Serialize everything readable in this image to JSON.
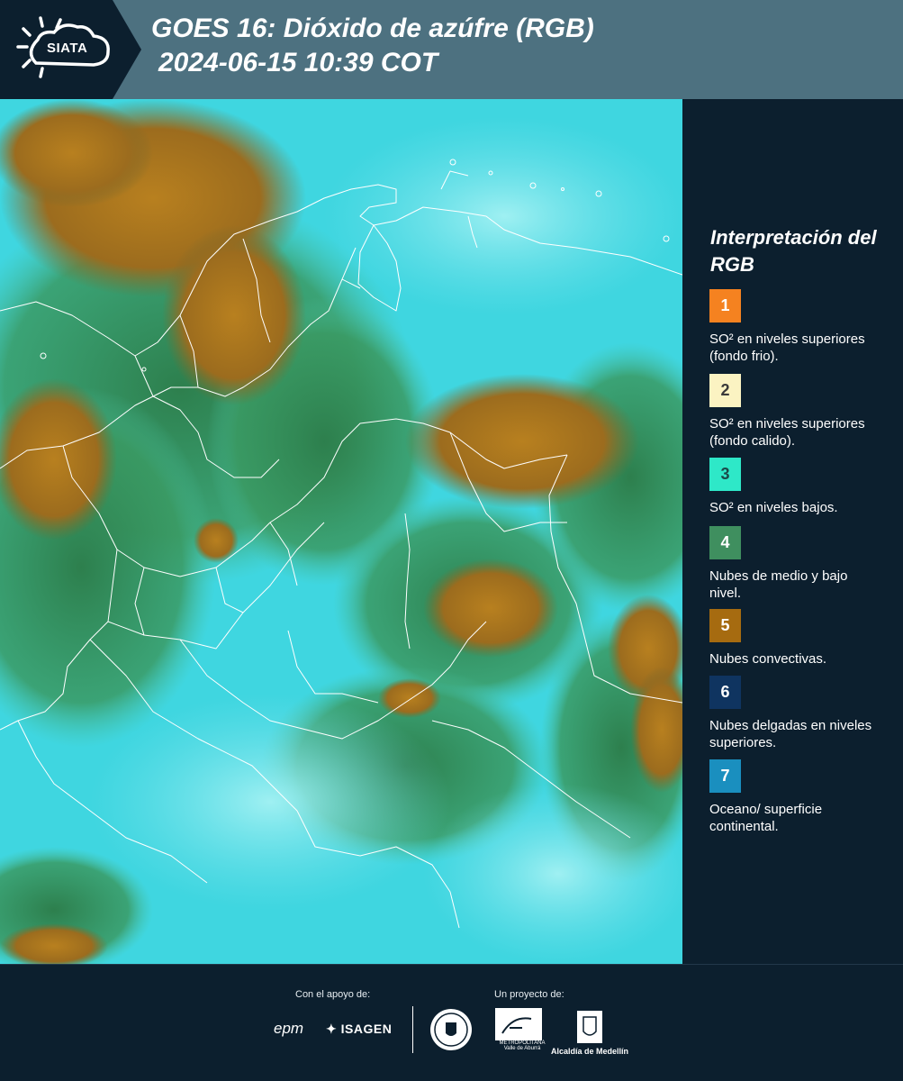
{
  "header": {
    "logo_text": "SIATA",
    "title": "GOES 16: Dióxido de azúfre (RGB)",
    "subtitle": "2024-06-15 10:39 COT"
  },
  "map": {
    "product": "GOES 16 SO2 RGB composite",
    "region": "Colombia",
    "colors": {
      "ocean_surface": "#3fd6e0",
      "mid_low_cloud": "#2f8a55",
      "convective_cloud": "#a8741f",
      "border_line": "#ffffff"
    }
  },
  "legend": {
    "title": "Interpretación del RGB",
    "items": [
      {
        "number": "1",
        "label": "SO² en niveles superiores (fondo frio).",
        "color": "#f58220",
        "text_color": "#ffffff"
      },
      {
        "number": "2",
        "label": "SO² en niveles superiores (fondo calido).",
        "color": "#fbf3c2",
        "text_color": "#3a3a3a"
      },
      {
        "number": "3",
        "label": "SO² en niveles bajos.",
        "color": "#2ee8c8",
        "text_color": "#1b4a4a"
      },
      {
        "number": "4",
        "label": "Nubes de medio y bajo nivel.",
        "color": "#3f8f5f",
        "text_color": "#ffffff"
      },
      {
        "number": "5",
        "label": "Nubes convectivas.",
        "color": "#a66b10",
        "text_color": "#ffffff"
      },
      {
        "number": "6",
        "label": "Nubes delgadas en niveles superiores.",
        "color": "#0f3460",
        "text_color": "#ffffff"
      },
      {
        "number": "7",
        "label": "Oceano/ superficie continental.",
        "color": "#1a8fbf",
        "text_color": "#ffffff"
      }
    ]
  },
  "footer": {
    "support_label": "Con el apoyo de:",
    "project_label": "Un proyecto de:",
    "sponsors": [
      "epm",
      "ISAGEN"
    ],
    "partners": [
      "Área Metropolitana Valle de Aburrá",
      "Alcaldía de Medellín"
    ],
    "area_text": "METROPOLITANA Valle de Aburrá",
    "alcaldia_text": "Alcaldía de Medellín"
  }
}
